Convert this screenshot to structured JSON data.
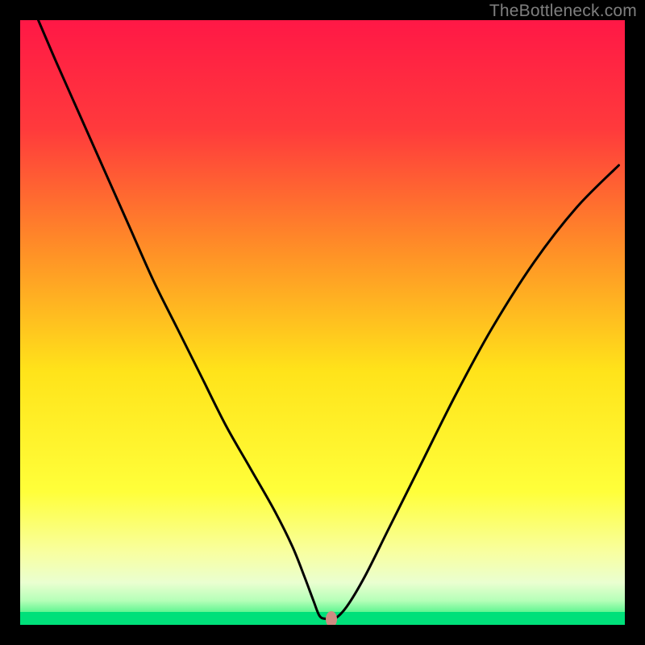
{
  "attribution": "TheBottleneck.com",
  "marker": {
    "x_pct": 51.5,
    "y_pct": 99.0,
    "color": "#cf8b82"
  },
  "gradient": {
    "stops": [
      {
        "pct": 0,
        "color": "#ff1846"
      },
      {
        "pct": 18,
        "color": "#ff3a3c"
      },
      {
        "pct": 38,
        "color": "#ff8f27"
      },
      {
        "pct": 58,
        "color": "#ffe31a"
      },
      {
        "pct": 78,
        "color": "#ffff3a"
      },
      {
        "pct": 88,
        "color": "#f8ffa0"
      },
      {
        "pct": 93,
        "color": "#eaffd0"
      },
      {
        "pct": 96,
        "color": "#b5ffb8"
      },
      {
        "pct": 98,
        "color": "#5cf58f"
      },
      {
        "pct": 100,
        "color": "#00e07a"
      }
    ]
  },
  "green_strip": {
    "top_pct": 97.8,
    "height_pct": 2.2,
    "color": "#00e07a"
  },
  "curve_stroke": "#000000",
  "chart_data": {
    "type": "line",
    "title": "",
    "xlabel": "",
    "ylabel": "",
    "xlim": [
      0,
      100
    ],
    "ylim": [
      0,
      100
    ],
    "note": "x and y in percent of plot area; y=0 is bottom (optimal), y=100 is top (worst)",
    "series": [
      {
        "name": "bottleneck-curve",
        "x": [
          3,
          6,
          10,
          14,
          18,
          22,
          26,
          30,
          34,
          38,
          42,
          45,
          47,
          48.5,
          49.5,
          50.5,
          52,
          54,
          57,
          61,
          66,
          72,
          78,
          85,
          92,
          99
        ],
        "y": [
          100,
          93,
          84,
          75,
          66,
          57,
          49,
          41,
          33,
          26,
          19,
          13,
          8,
          4,
          1.5,
          1,
          1,
          3,
          8,
          16,
          26,
          38,
          49,
          60,
          69,
          76
        ]
      }
    ],
    "marker_point": {
      "x": 51.5,
      "y": 1
    }
  }
}
